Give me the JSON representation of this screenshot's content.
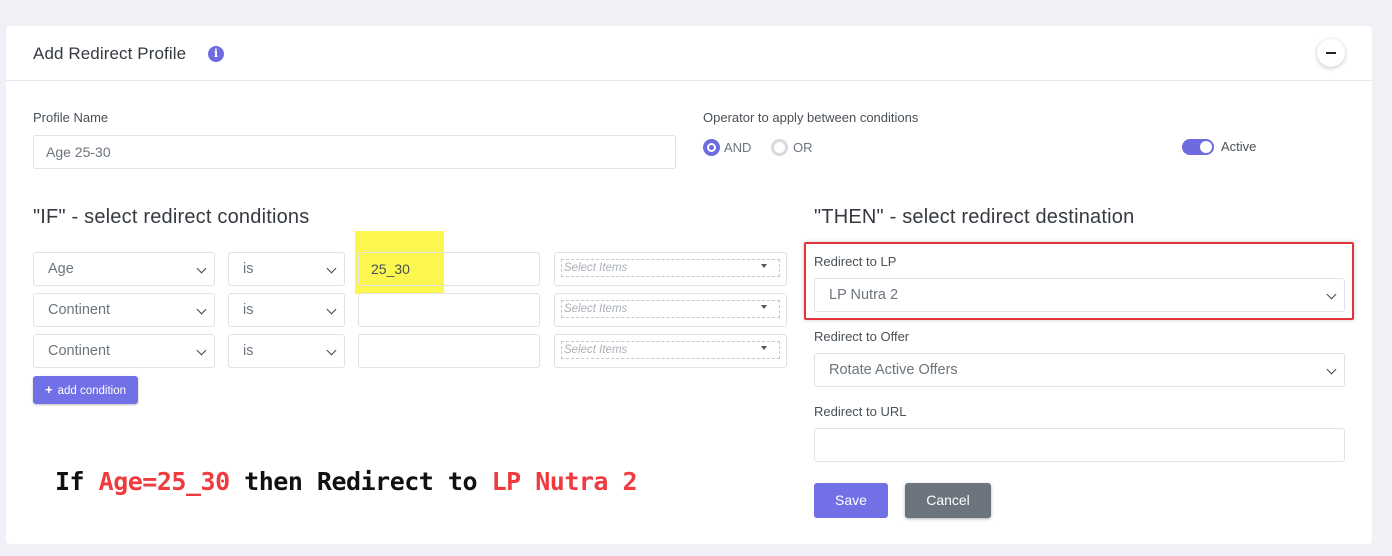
{
  "header": {
    "title": "Add Redirect Profile",
    "info_icon": "i"
  },
  "profile": {
    "label": "Profile Name",
    "value": "Age 25-30"
  },
  "operator": {
    "label": "Operator to apply between conditions",
    "options": [
      {
        "label": "AND",
        "selected": true
      },
      {
        "label": "OR",
        "selected": false
      }
    ]
  },
  "active": {
    "label": "Active",
    "enabled": true
  },
  "conditions": {
    "title": "\"IF\" - select redirect conditions",
    "rows": [
      {
        "field": "Age",
        "operator": "is",
        "value": "25_30",
        "items_placeholder": "Select Items"
      },
      {
        "field": "Continent",
        "operator": "is",
        "value": "",
        "items_placeholder": "Select Items"
      },
      {
        "field": "Continent",
        "operator": "is",
        "value": "",
        "items_placeholder": "Select Items"
      }
    ],
    "add_button": "add condition",
    "add_icon": "+"
  },
  "destination": {
    "title": "\"THEN\" - select redirect destination",
    "lp_label": "Redirect to LP",
    "lp_value": "LP Nutra 2",
    "offer_label": "Redirect to Offer",
    "offer_value": "Rotate Active Offers",
    "url_label": "Redirect to URL",
    "url_value": ""
  },
  "buttons": {
    "save": "Save",
    "cancel": "Cancel"
  },
  "annotation": {
    "part1": "If ",
    "part2": "Age=25_30",
    "part3": " then Redirect to ",
    "part4": "LP Nutra 2",
    "accent_color": "#ef3a3e"
  },
  "colors": {
    "accent": "#7170e6",
    "highlight": "#fbf750",
    "callout_border": "#e0353a"
  }
}
